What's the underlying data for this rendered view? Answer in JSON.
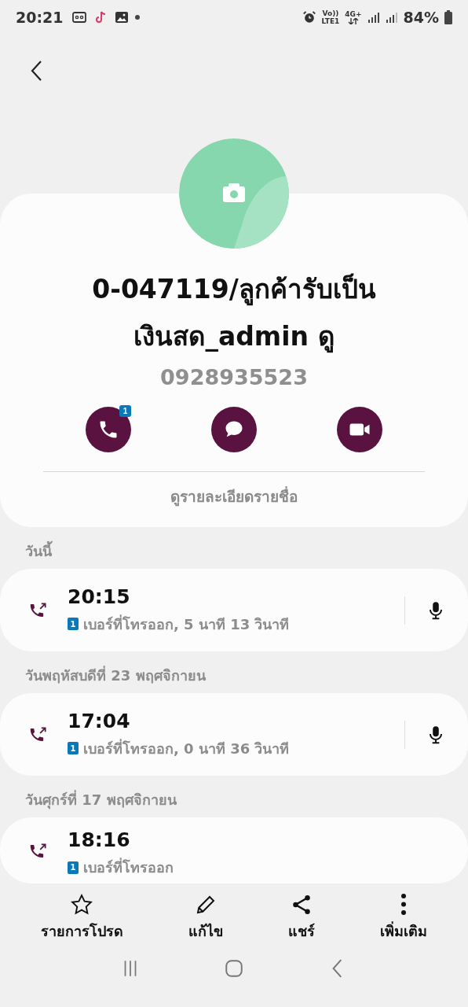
{
  "status_bar": {
    "time": "20:21",
    "volte": "Vo))",
    "lte": "LTE1",
    "network": "4G+",
    "battery": "84%"
  },
  "contact": {
    "name": "0-047119/ลูกค้ารับเป็นเงินสด_admin ดู",
    "number": "0928935523",
    "call_badge": "1",
    "details_link": "ดูรายละเอียดรายชื่อ"
  },
  "call_log": [
    {
      "date": "วันนี้",
      "time": "20:15",
      "sim": "1",
      "detail": "เบอร์ที่โทรออก, 5 นาที 13 วินาที",
      "recording": true
    },
    {
      "date": "วันพฤหัสบดีที่ 23 พฤศจิกายน",
      "time": "17:04",
      "sim": "1",
      "detail": "เบอร์ที่โทรออก, 0 นาที 36 วินาที",
      "recording": true
    },
    {
      "date": "วันศุกร์ที่ 17 พฤศจิกายน",
      "time": "18:16",
      "sim": "1",
      "detail": "เบอร์ที่โทรออก",
      "recording": false
    }
  ],
  "bottom_actions": [
    {
      "kind": "star",
      "label": "รายการโปรด"
    },
    {
      "kind": "edit",
      "label": "แก้ไข"
    },
    {
      "kind": "share",
      "label": "แชร์"
    },
    {
      "kind": "more",
      "label": "เพิ่มเติม"
    }
  ]
}
